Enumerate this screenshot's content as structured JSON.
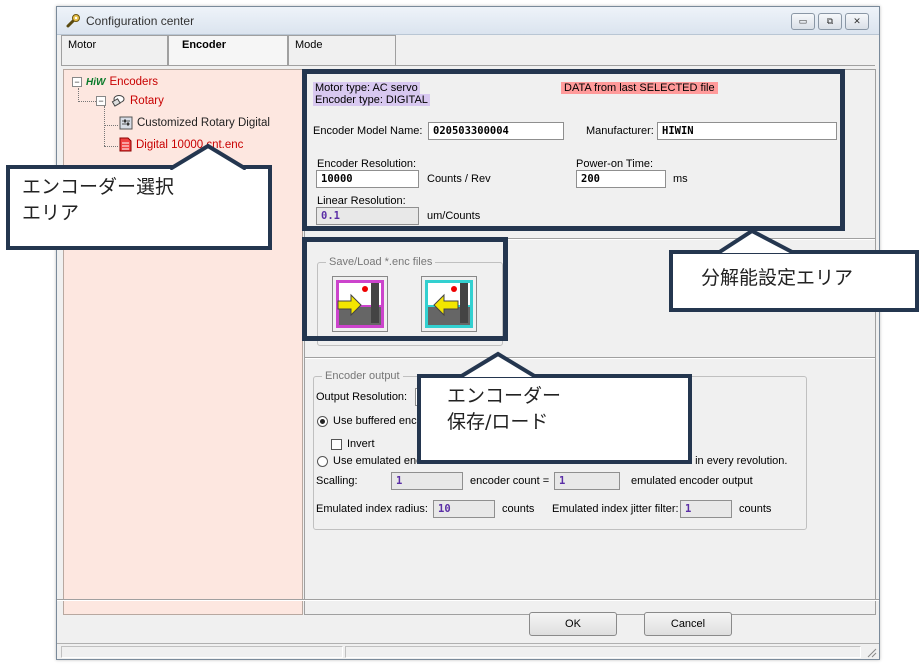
{
  "window": {
    "title": "Configuration center",
    "controls": [
      "▭",
      "⧉",
      "✕"
    ]
  },
  "tabs": [
    {
      "label": "Motor",
      "active": false
    },
    {
      "label": "Encoder",
      "active": true
    },
    {
      "label": "Mode",
      "active": false
    }
  ],
  "tree": {
    "root": "Encoders",
    "root_logo": "HiW",
    "expand_symbol": "−",
    "child": "Rotary",
    "items": [
      "Customized Rotary Digital",
      "Digital 10000 cnt.enc"
    ]
  },
  "info": {
    "motor_type": "Motor  type: AC servo",
    "encoder_type": "Encoder type: DIGITAL",
    "data_source": "DATA from last SELECTED file"
  },
  "fields": {
    "model_name_label": "Encoder Model Name:",
    "model_name_value": "020503300004",
    "manufacturer_label": "Manufacturer:",
    "manufacturer_value": "HIWIN",
    "resolution_label": "Encoder Resolution:",
    "resolution_value": "10000",
    "resolution_unit": "Counts / Rev",
    "power_on_label": "Power-on Time:",
    "power_on_value": "200",
    "power_on_unit": "ms",
    "linear_label": "Linear Resolution:",
    "linear_value": "0.1",
    "linear_unit": "um/Counts"
  },
  "saveload": {
    "legend": "Save/Load *.enc files"
  },
  "encoder_output": {
    "legend": "Encoder output",
    "output_resolution_label": "Output Resolution:",
    "use_buffered_label": "Use buffered enco",
    "invert_label": "Invert",
    "use_emulated_label": "Use emulated enc",
    "revolution_note": "t in every revolution.",
    "scaling_label": "Scalling:",
    "scaling_value": "1",
    "encoder_count_label": "encoder count =",
    "encoder_count_value": "1",
    "emulated_output_label": "emulated encoder output",
    "index_radius_label": "Emulated index radius:",
    "index_radius_value": "10",
    "index_radius_unit": "counts",
    "jitter_label": "Emulated index jitter filter:",
    "jitter_value": "1",
    "jitter_unit": "counts"
  },
  "buttons": {
    "ok": "OK",
    "cancel": "Cancel"
  },
  "annotations": {
    "encoder_select": [
      "エンコーダー選択",
      "エリア"
    ],
    "resolution_area": "分解能設定エリア",
    "save_load": [
      "エンコーダー",
      "保存/ロード"
    ]
  },
  "colors": {
    "annotation_border": "#24364f",
    "tree_bg": "#fde7e0",
    "tree_text": "#c80000"
  }
}
